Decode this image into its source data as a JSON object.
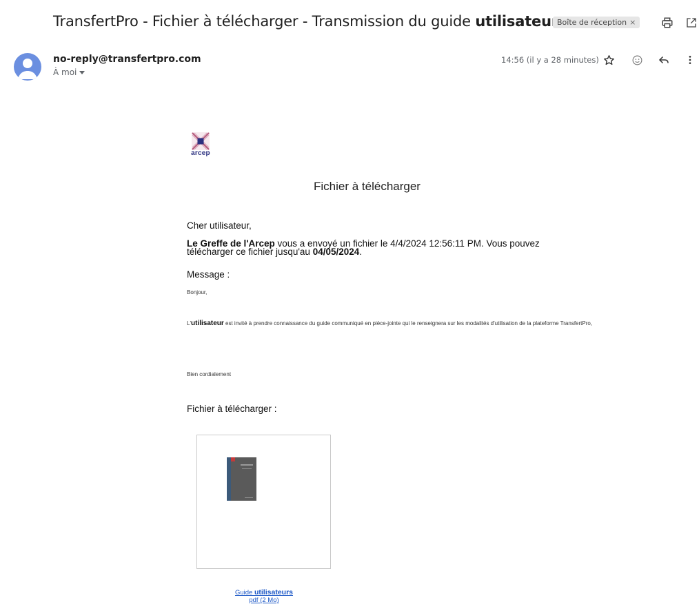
{
  "email": {
    "subject_prefix": "TransfertPro - Fichier à télécharger - Transmission du guide",
    "subject_highlight": "utilisateurs",
    "label": "Boîte de réception",
    "label_close": "×",
    "sender": "no-reply@transfertpro.com",
    "recipient": "À moi",
    "time": "14:56 (il y a 28 minutes)"
  },
  "icons": {
    "print": "print-icon",
    "popout": "open-in-new-window-icon",
    "star": "star-icon",
    "emoji": "emoji-reaction-icon",
    "reply": "reply-icon",
    "more": "more-vertical-icon",
    "avatar": "person-avatar-icon"
  },
  "content": {
    "logo_text": "arcep",
    "title": "Fichier à télécharger",
    "greeting": "Cher utilisateur,",
    "sender_org": "Le Greffe de l'Arcep",
    "sent_text": " vous a envoyé un fichier le 4/4/2024 12:56:11 PM. Vous pouvez télécharger ce fichier jusqu'au ",
    "expiry": "04/05/2024",
    "sent_end": ".",
    "message_label": "Message :",
    "msg_hello": "Bonjour,",
    "msg_prefix": "L'",
    "msg_highlight": "utilisateur",
    "msg_body": "  est invité à prendre connaissance du guide communiqué en pièce-jointe qui le renseignera sur les modalités d'utilisation de la plateforme TransfertPro,",
    "msg_closing": "Bien cordialement",
    "files_label": "Fichier à télécharger :",
    "file_name_prefix": "Guide ",
    "file_name_highlight": "utilisateurs",
    "file_meta": "pdf (2 Mo)"
  },
  "colors": {
    "link": "#1a56c6",
    "avatar": "#6b8fe0",
    "logo_text": "#2a2f7f",
    "label_chip": "#e6e6e6"
  }
}
